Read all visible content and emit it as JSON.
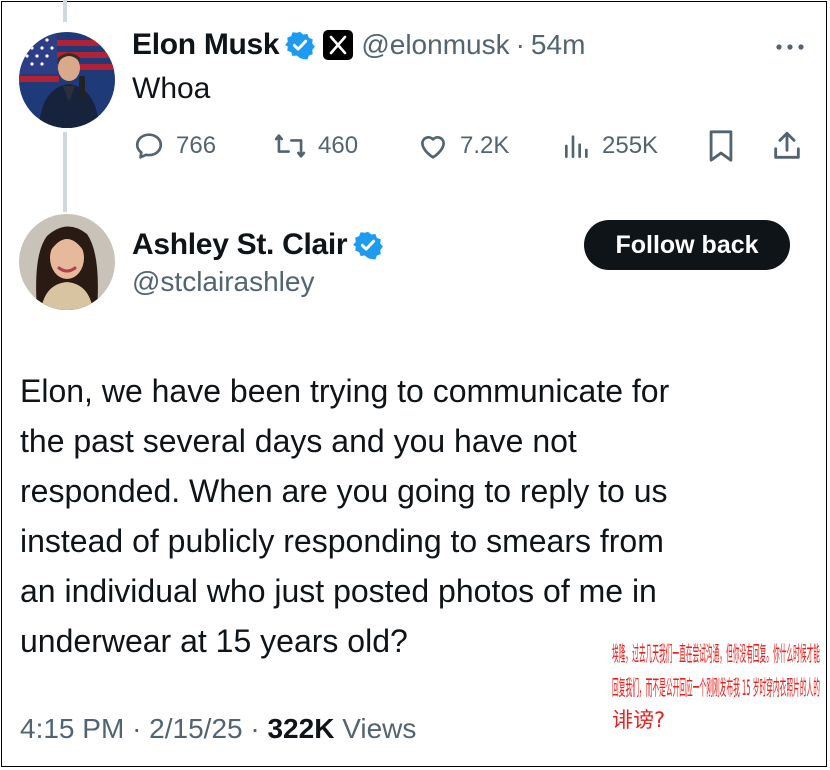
{
  "reply": {
    "author_name": "Elon Musk",
    "handle": "@elonmusk",
    "time": "54m",
    "separator": "·",
    "text": "Whoa",
    "stats": {
      "replies": "766",
      "reposts": "460",
      "likes": "7.2K",
      "views": "255K"
    }
  },
  "quoted": {
    "author_name": "Ashley St. Clair",
    "handle": "@stclairashley",
    "follow_label": "Follow back",
    "body_lines": [
      "Elon, we have been trying to communicate for",
      "the past several days and you have not",
      "responded. When are you going to reply to us",
      "instead of publicly responding to smears from",
      "an individual who just posted photos of me in",
      "underwear at 15 years old?"
    ],
    "time": "4:15 PM",
    "date": "2/15/25",
    "views_count": "322K",
    "views_label": "Views",
    "separator": "·"
  },
  "translation_overlay": {
    "lines": [
      "埃隆，过去几天我们一直在尝试沟通，但你没有回复。你什么时候才能",
      "回复我们，而不是公开回应一个刚刚发布我 15 岁时穿内衣照片的人的",
      "诽谤?"
    ]
  },
  "colors": {
    "text": "#0f1419",
    "secondary": "#536471",
    "verified": "#1d9bf0",
    "overlay": "#e8201c",
    "button": "#0f1419"
  },
  "icons": [
    "verified-badge-icon",
    "x-logo-icon",
    "more-icon",
    "reply-icon",
    "repost-icon",
    "like-icon",
    "views-icon",
    "bookmark-icon",
    "share-icon"
  ]
}
